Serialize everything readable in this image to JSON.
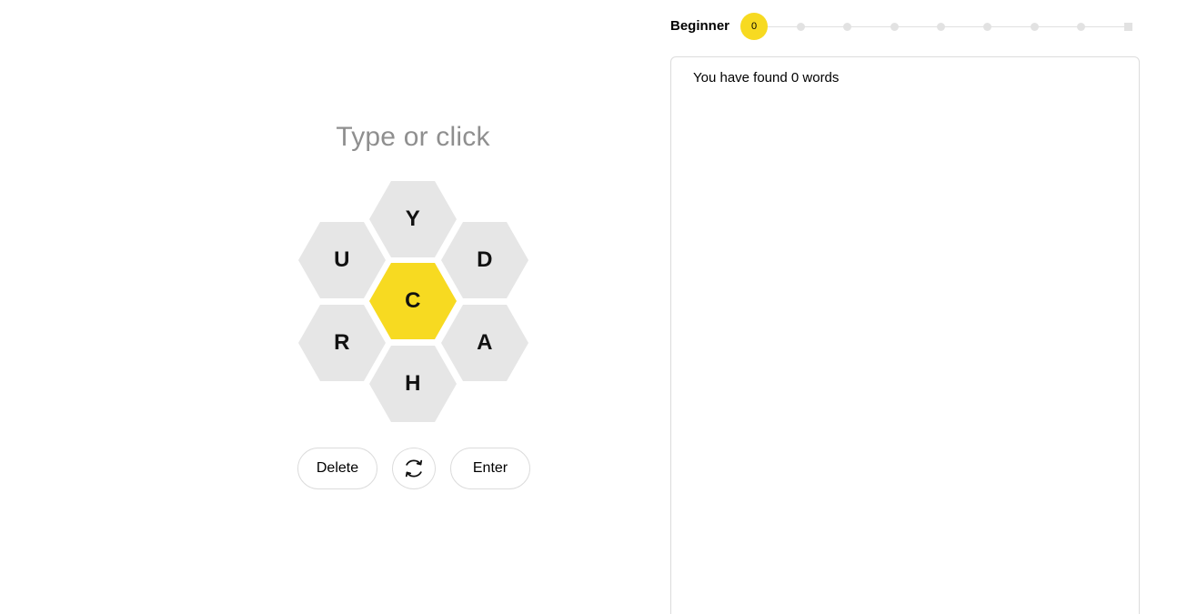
{
  "game": {
    "input_placeholder": "Type or click",
    "letters": {
      "center": "C",
      "top": "Y",
      "upper_left": "U",
      "upper_right": "D",
      "lower_left": "R",
      "lower_right": "A",
      "bottom": "H"
    }
  },
  "controls": {
    "delete_label": "Delete",
    "shuffle_icon": "shuffle-icon",
    "enter_label": "Enter"
  },
  "progress": {
    "rank": "Beginner",
    "score": "0",
    "rank_steps": 9,
    "current_step": 0
  },
  "wordlist": {
    "summary": "You have found 0 words",
    "words": []
  },
  "colors": {
    "center_hex": "#f7da21",
    "outer_hex": "#e6e6e6",
    "placeholder": "#8f8f8f"
  }
}
